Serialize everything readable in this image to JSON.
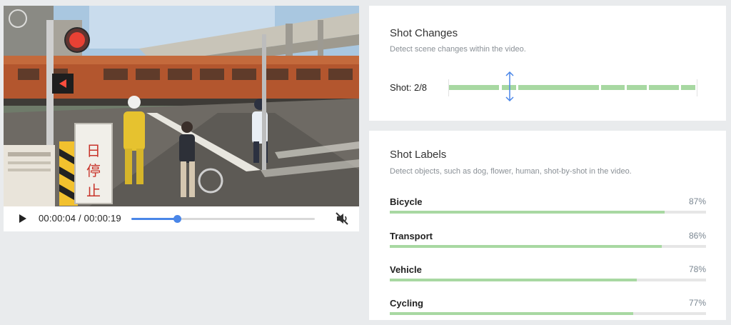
{
  "player": {
    "time_display": "00:00:04 / 00:00:19",
    "progress": 0.25,
    "play_icon": "play-icon",
    "mute_icon": "volume-muted-icon",
    "accent_color": "#4a86e8"
  },
  "shot_changes": {
    "title": "Shot Changes",
    "description": "Detect scene changes within the video.",
    "counter": "Shot: 2/8",
    "segment_color": "#a8d8a2",
    "cursor_color": "#4a86e8",
    "current_shot": 2,
    "total_shots": 8
  },
  "shot_labels": {
    "title": "Shot Labels",
    "description": "Detect objects, such as dog, flower, human, shot-by-shot in the video.",
    "bar_color": "#a8d8a2",
    "items": [
      {
        "name": "Bicycle",
        "percent": "87%",
        "value": 0.87
      },
      {
        "name": "Transport",
        "percent": "86%",
        "value": 0.86
      },
      {
        "name": "Vehicle",
        "percent": "78%",
        "value": 0.78
      },
      {
        "name": "Cycling",
        "percent": "77%",
        "value": 0.77
      }
    ]
  }
}
